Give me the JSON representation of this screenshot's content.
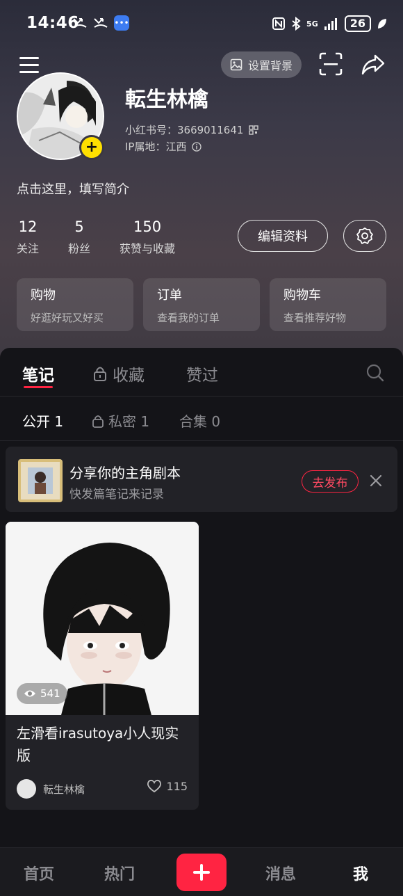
{
  "status_bar": {
    "time": "14:46",
    "battery": "26",
    "network": "5G"
  },
  "top_bar": {
    "set_background_label": "设置背景"
  },
  "profile": {
    "name": "転生林檎",
    "uid_label": "小红书号：3669011641",
    "ip_label": "IP属地：江西",
    "bio": "点击这里，填写简介"
  },
  "stats": [
    {
      "num": "12",
      "label": "关注"
    },
    {
      "num": "5",
      "label": "粉丝"
    },
    {
      "num": "150",
      "label": "获赞与收藏"
    }
  ],
  "actions": {
    "edit_label": "编辑资料"
  },
  "cards": [
    {
      "title": "购物",
      "subtitle": "好逛好玩又好买"
    },
    {
      "title": "订单",
      "subtitle": "查看我的订单"
    },
    {
      "title": "购物车",
      "subtitle": "查看推荐好物"
    }
  ],
  "tabs": [
    {
      "label": "笔记"
    },
    {
      "label": "收藏"
    },
    {
      "label": "赞过"
    }
  ],
  "subtabs": [
    {
      "label": "公开 1"
    },
    {
      "label": "私密 1"
    },
    {
      "label": "合集 0"
    }
  ],
  "promo": {
    "title": "分享你的主角剧本",
    "subtitle": "快发篇笔记来记录",
    "button": "去发布"
  },
  "note": {
    "views": "541",
    "title": "左滑看irasutoya小人现实版",
    "author": "転生林檎",
    "likes": "115"
  },
  "bottom_nav": [
    {
      "label": "首页"
    },
    {
      "label": "热门"
    },
    {
      "label": "消息"
    },
    {
      "label": "我"
    }
  ],
  "colors": {
    "accent": "#ff2442",
    "background": "#141418",
    "badge": "#ffe000"
  }
}
